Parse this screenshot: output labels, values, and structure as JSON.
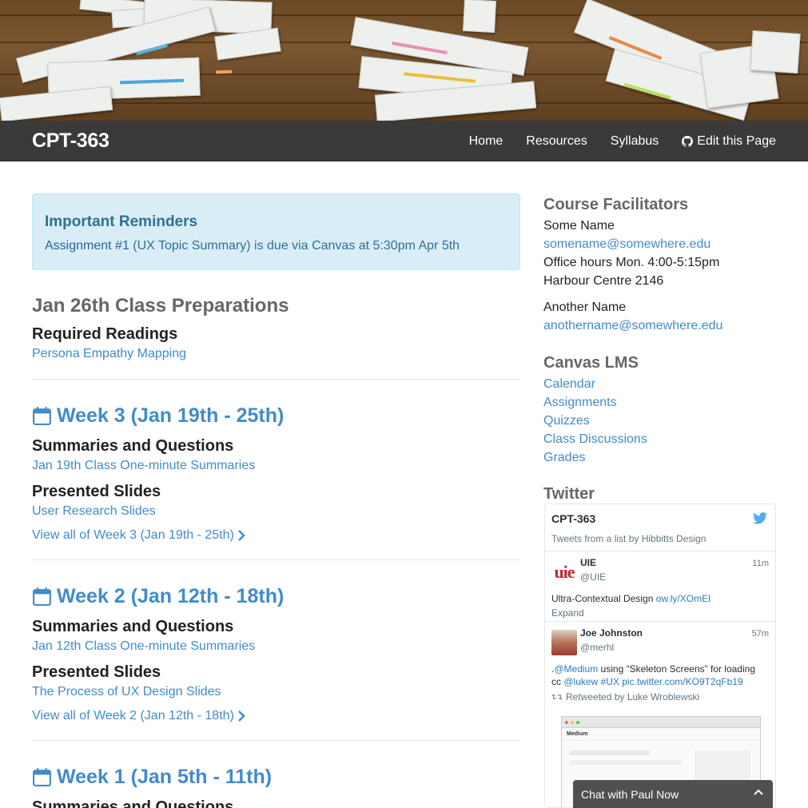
{
  "navbar": {
    "brand": "CPT-363",
    "links": [
      {
        "label": "Home"
      },
      {
        "label": "Resources"
      },
      {
        "label": "Syllabus"
      },
      {
        "label": "Edit this Page",
        "icon": "github-icon"
      }
    ]
  },
  "alert": {
    "title": "Important Reminders",
    "link": "Assignment #1",
    "text": " (UX Topic Summary) is due via Canvas at 5:30pm Apr 5th"
  },
  "prep": {
    "title": "Jan 26th Class Preparations",
    "heading": "Required Readings",
    "link": "Persona Empathy Mapping"
  },
  "weeks": [
    {
      "title": "Week 3 (Jan 19th - 25th)",
      "summaries_heading": "Summaries and Questions",
      "summaries_link": "Jan 19th Class One-minute Summaries",
      "slides_heading": "Presented Slides",
      "slides_link": "User Research Slides",
      "view_all": "View all of Week 3 (Jan 19th - 25th)"
    },
    {
      "title": "Week 2 (Jan 12th - 18th)",
      "summaries_heading": "Summaries and Questions",
      "summaries_link": "Jan 12th Class One-minute Summaries",
      "slides_heading": "Presented Slides",
      "slides_link": "The Process of UX Design Slides",
      "view_all": "View all of Week 2 (Jan 12th - 18th)"
    },
    {
      "title": "Week 1 (Jan 5th - 11th)",
      "summaries_heading": "Summaries and Questions"
    }
  ],
  "sidebar": {
    "facilitators_title": "Course Facilitators",
    "facilitator1": {
      "name": "Some Name",
      "email": "somename@somewhere.edu",
      "hours": "Office hours Mon. 4:00-5:15pm",
      "location": "Harbour Centre 2146"
    },
    "facilitator2": {
      "name": "Another Name",
      "email": "anothername@somewhere.edu"
    },
    "canvas_title": "Canvas LMS",
    "canvas_links": [
      "Calendar",
      "Assignments",
      "Quizzes",
      "Class Discussions",
      "Grades"
    ],
    "twitter_title": "Twitter"
  },
  "twitter": {
    "list_name": "CPT-363",
    "list_sub": "Tweets from a list by Hibbitts Design",
    "tweets": [
      {
        "name": "UIE",
        "handle": "@UIE",
        "time": "11m",
        "text": "Ultra-Contextual Design ",
        "link": "ow.ly/XOmEl",
        "expand": "Expand",
        "avatar_text": "uie"
      },
      {
        "name": "Joe Johnston",
        "handle": "@merhl",
        "time": "57m",
        "prefix": ".",
        "mention": "@Medium",
        "text": " using “Skeleton Screens” for loading",
        "cc": "cc ",
        "mention2": "@lukew",
        "hashtag": "#UX",
        "pic": "pic.twitter.com/KO9T2qFb19",
        "retweet": "Retweeted by Luke Wroblewski",
        "thumb_brand": "Medium"
      }
    ]
  },
  "chat": {
    "label": "Chat with Paul Now"
  },
  "colors": {
    "link": "#428bca",
    "navbar": "#3a3a3a",
    "alert_bg": "#d9edf7",
    "alert_text": "#31708f"
  }
}
